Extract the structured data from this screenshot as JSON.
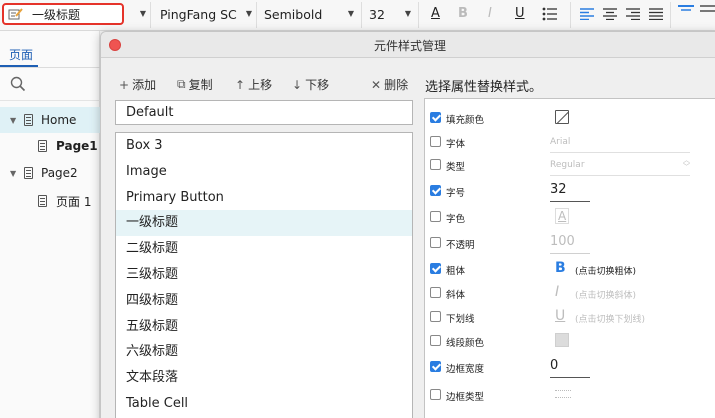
{
  "toolbar": {
    "style_name": "一级标题",
    "font_family": "PingFang SC",
    "font_weight": "Semibold",
    "font_size": "32",
    "format_buttons": [
      "A",
      "B",
      "I",
      "U"
    ]
  },
  "left_panel": {
    "tab_label": "页面",
    "tree": [
      {
        "label": "Home",
        "level": 0,
        "expanded": true
      },
      {
        "label": "Page1",
        "level": 1
      },
      {
        "label": "Page2",
        "level": 0,
        "expanded": true
      },
      {
        "label": "页面 1",
        "level": 1
      }
    ]
  },
  "dialog": {
    "title": "元件样式管理",
    "actions": [
      {
        "icon": "plus-icon",
        "glyph": "+",
        "label": "添加"
      },
      {
        "icon": "copy-icon",
        "glyph": "⧉",
        "label": "复制"
      },
      {
        "icon": "arrow-up-icon",
        "glyph": "↑",
        "label": "上移"
      },
      {
        "icon": "arrow-down-icon",
        "glyph": "↓",
        "label": "下移"
      },
      {
        "icon": "close-x-icon",
        "glyph": "✕",
        "label": "删除"
      }
    ],
    "default_style": "Default",
    "styles": [
      "Box 3",
      "Image",
      "Primary Button",
      "一级标题",
      "二级标题",
      "三级标题",
      "四级标题",
      "五级标题",
      "六级标题",
      "文本段落",
      "Table Cell"
    ],
    "selected_style": "一级标题",
    "properties_heading": "选择属性替换样式。",
    "properties": {
      "fill_color": {
        "label": "填充颜色",
        "checked": true
      },
      "font": {
        "label": "字体",
        "checked": false,
        "value": "Arial"
      },
      "type": {
        "label": "类型",
        "checked": false,
        "value": "Regular"
      },
      "font_size": {
        "label": "字号",
        "checked": true,
        "value": "32"
      },
      "font_color": {
        "label": "字色",
        "checked": false,
        "value": "A"
      },
      "opacity": {
        "label": "不透明",
        "checked": false,
        "value": "100"
      },
      "bold": {
        "label": "粗体",
        "checked": true,
        "glyph": "B",
        "hint": "(点击切换粗体)"
      },
      "italic": {
        "label": "斜体",
        "checked": false,
        "glyph": "I",
        "hint": "(点击切换斜体)"
      },
      "underline": {
        "label": "下划线",
        "checked": false,
        "glyph": "U",
        "hint": "(点击切换下划线)"
      },
      "line_color": {
        "label": "线段颜色",
        "checked": false
      },
      "border_width": {
        "label": "边框宽度",
        "checked": true,
        "value": "0"
      },
      "border_type": {
        "label": "边框类型",
        "checked": false
      }
    }
  },
  "colors": {
    "highlight_red": "#e5332a",
    "accent_blue": "#2a7de1",
    "selected_row": "#e6f4f7",
    "close_button": "#ef5451"
  }
}
